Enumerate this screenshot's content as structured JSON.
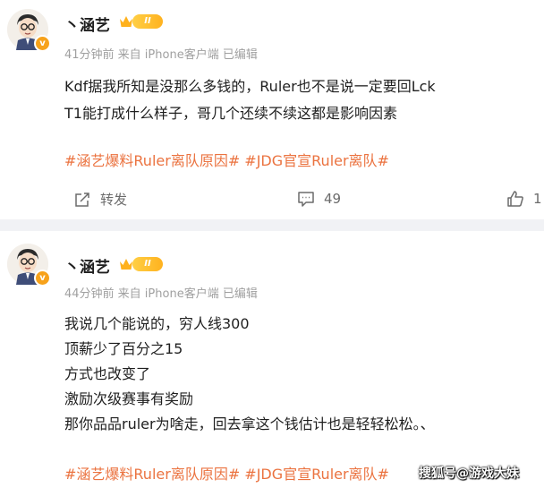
{
  "posts": [
    {
      "author": "丶涵艺",
      "level": "II",
      "meta": "41分钟前 来自 iPhone客户端 已编辑",
      "lines": [
        "Kdf据我所知是没那么多钱的，Ruler也不是说一定要回Lck",
        "T1能打成什么样子，哥几个还续不续这都是影响因素"
      ],
      "topics": "#涵艺爆料Ruler离队原因# #JDG官宣Ruler离队#",
      "actions": {
        "repost": "转发",
        "comments": "49",
        "likes": "1"
      }
    },
    {
      "author": "丶涵艺",
      "level": "II",
      "meta": "44分钟前 来自 iPhone客户端 已编辑",
      "lines": [
        "我说几个能说的，穷人线300",
        "顶薪少了百分之15",
        "方式也改变了",
        "激励次级赛事有奖励",
        "那你品品ruler为啥走，回去拿这个钱估计也是轻轻松松。、"
      ],
      "topics": "#涵艺爆料Ruler离队原因# #JDG官宣Ruler离队#"
    }
  ],
  "watermark": "搜狐号@游戏大妹",
  "colors": {
    "topic": "#eb7340",
    "meta": "#a0a0a0",
    "separator": "#f1f2f5",
    "vip": "#f7a21b"
  },
  "icons": [
    "avatar",
    "crown-icon",
    "level-badge",
    "repost-icon",
    "comment-icon",
    "like-icon"
  ]
}
